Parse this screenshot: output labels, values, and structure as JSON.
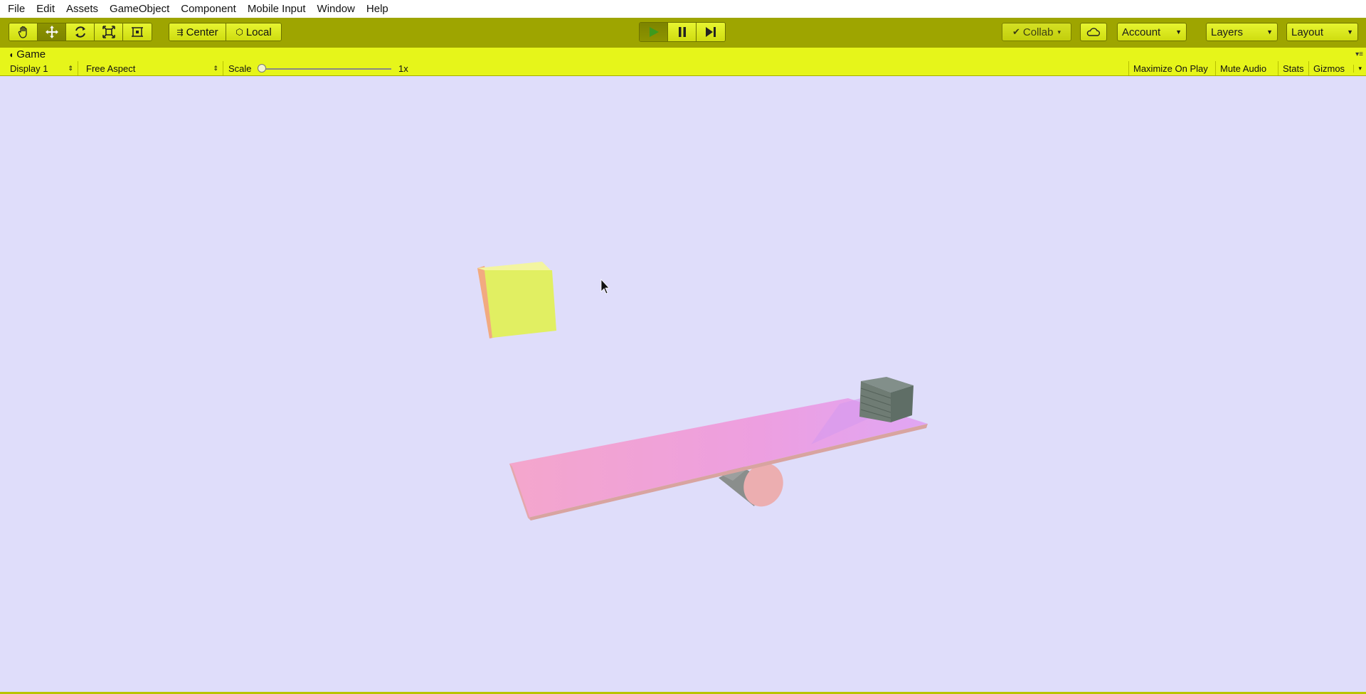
{
  "menu": [
    "File",
    "Edit",
    "Assets",
    "GameObject",
    "Component",
    "Mobile Input",
    "Window",
    "Help"
  ],
  "toolbar": {
    "tools": [
      "hand-icon",
      "move-icon",
      "rotate-icon",
      "scale-icon",
      "rect-tool-icon"
    ],
    "active_tool": "move-icon",
    "pivot_label": "Center",
    "rotation_label": "Local",
    "collab_label": "Collab",
    "account_label": "Account",
    "layers_label": "Layers",
    "layout_label": "Layout"
  },
  "game": {
    "tab_label": "Game",
    "display_label": "Display 1",
    "aspect_label": "Free Aspect",
    "scale_label": "Scale",
    "scale_value": "1x",
    "maximize_label": "Maximize On Play",
    "mute_label": "Mute Audio",
    "stats_label": "Stats",
    "gizmos_label": "Gizmos"
  },
  "colors": {
    "toolbar_bg": "#9ea500",
    "panel_bg": "#e6f51a",
    "viewport_bg": "#dfddfa",
    "cube_yellow": "#e1ef62",
    "plank_pink": "#f0a6d8",
    "crate_gray": "#6a7a70"
  }
}
